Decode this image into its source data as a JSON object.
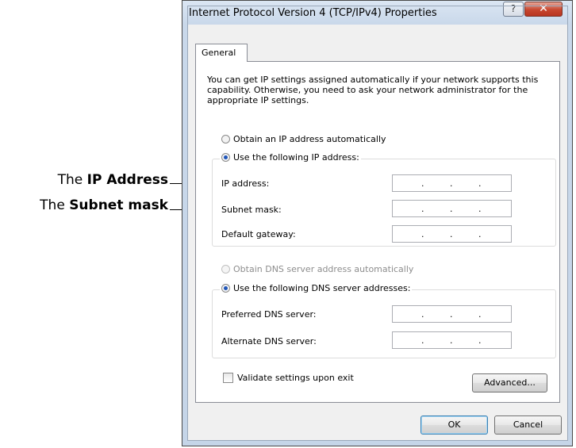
{
  "callouts": {
    "ip_prefix": "The ",
    "ip_bold": "IP Address",
    "subnet_prefix": "The ",
    "subnet_bold": "Subnet mask"
  },
  "window": {
    "title": "Internet Protocol Version 4 (TCP/IPv4) Properties",
    "help_glyph": "?",
    "close_glyph": "✕"
  },
  "tabs": [
    {
      "label": "General",
      "selected": true
    }
  ],
  "description": "You can get IP settings assigned automatically if your network supports this capability. Otherwise, you need to ask your network administrator for the appropriate IP settings.",
  "ip_section": {
    "auto_label": "Obtain an IP address automatically",
    "auto_checked": false,
    "manual_label": "Use the following IP address:",
    "manual_checked": true,
    "fields": [
      {
        "label": "IP address:",
        "value": ".    .    ."
      },
      {
        "label": "Subnet mask:",
        "value": ".    .    ."
      },
      {
        "label": "Default gateway:",
        "value": ".    .    ."
      }
    ]
  },
  "dns_section": {
    "auto_label": "Obtain DNS server address automatically",
    "auto_checked": false,
    "auto_disabled": true,
    "manual_label": "Use the following DNS server addresses:",
    "manual_checked": true,
    "fields": [
      {
        "label": "Preferred DNS server:",
        "value": ".    .    ."
      },
      {
        "label": "Alternate DNS server:",
        "value": ".    .    ."
      }
    ]
  },
  "validate": {
    "label": "Validate settings upon exit",
    "checked": false
  },
  "buttons": {
    "advanced": "Advanced...",
    "ok": "OK",
    "cancel": "Cancel"
  }
}
